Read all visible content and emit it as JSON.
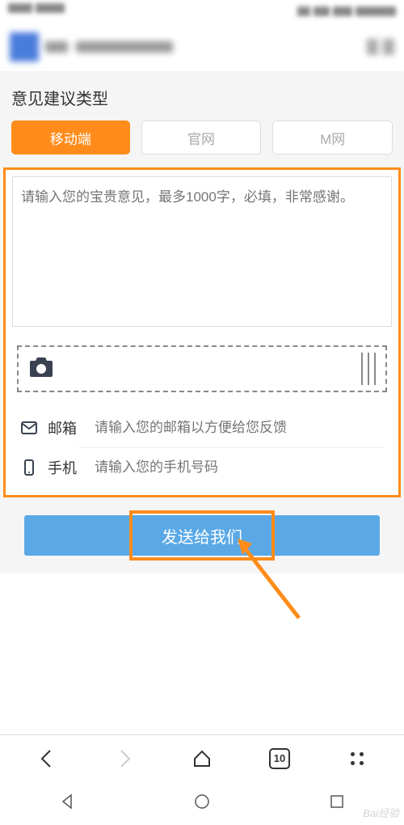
{
  "section": {
    "title": "意见建议类型"
  },
  "tabs": [
    {
      "label": "移动端",
      "active": true
    },
    {
      "label": "官网",
      "active": false
    },
    {
      "label": "M网",
      "active": false
    }
  ],
  "textarea": {
    "placeholder": "请输入您的宝贵意见，最多1000字，必填，非常感谢。"
  },
  "fields": {
    "email": {
      "label": "邮箱",
      "placeholder": "请输入您的邮箱以方便给您反馈"
    },
    "phone": {
      "label": "手机",
      "placeholder": "请输入您的手机号码"
    }
  },
  "submit": {
    "label": "发送给我们"
  },
  "browser": {
    "tab_count": "10"
  },
  "watermark": "Bai经验"
}
